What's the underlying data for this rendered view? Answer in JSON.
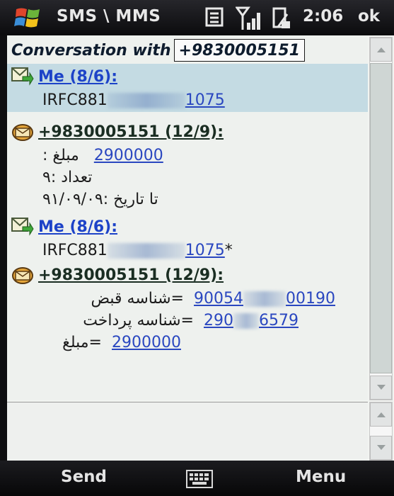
{
  "statusbar": {
    "app_title": "SMS \\ MMS",
    "time": "2:06",
    "ok_label": "ok",
    "icons": [
      "windows-logo-icon",
      "message-icon",
      "signal-icon",
      "battery-icon"
    ]
  },
  "conversation": {
    "label": "Conversation with",
    "number": "+9830005151"
  },
  "messages": [
    {
      "sender": "Me (8/6):",
      "body_prefix": "IRFC881",
      "body_suffix": "1075",
      "icon": "sent-message-icon"
    },
    {
      "sender": "+9830005151 (12/9):",
      "icon": "received-message-icon",
      "amount_label": "مبلغ :",
      "amount_value": "2900000",
      "count_line": "تعداد :۹",
      "date_line": "تا تاریخ :۹۱/۰۹/۰۹"
    },
    {
      "sender": "Me (8/6):",
      "body_prefix": "IRFC881",
      "body_suffix": "1075",
      "body_star": "*",
      "icon": "sent-message-icon"
    },
    {
      "sender": "+9830005151 (12/9):",
      "icon": "received-message-icon",
      "bill_label": "=شناسه قبض",
      "bill_prefix": "90054",
      "bill_suffix": "00190",
      "pay_label": "=شناسه پرداخت",
      "pay_prefix": "290",
      "pay_suffix": "6579",
      "amount_label": "=مبلغ",
      "amount_value": "2900000"
    }
  ],
  "softkeys": {
    "left": "Send",
    "right": "Menu",
    "center_icon": "keyboard-icon"
  },
  "colors": {
    "selected_bg": "#c4dbe3",
    "link": "#2a47c0",
    "sender_me": "#1d43c8"
  }
}
